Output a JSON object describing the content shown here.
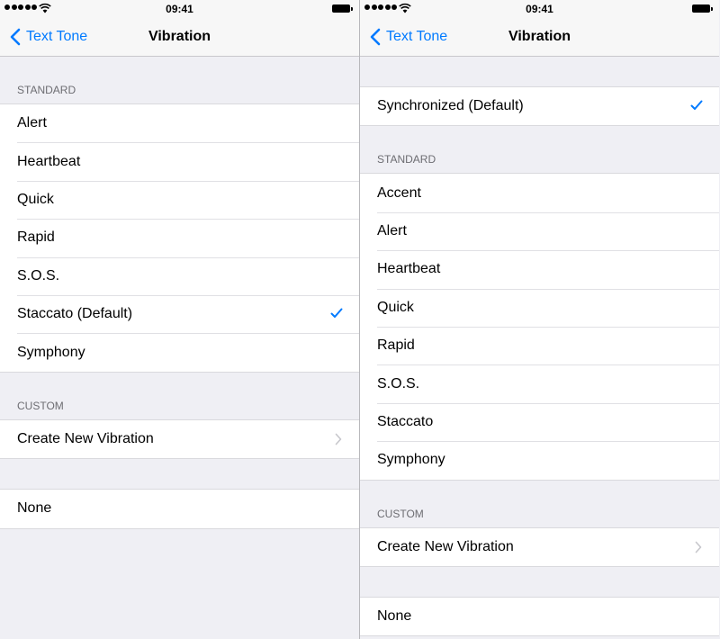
{
  "colors": {
    "accent": "#007aff",
    "background": "#efeff4",
    "header_text": "#6d6d72"
  },
  "left": {
    "status": {
      "time": "09:41"
    },
    "nav": {
      "back": "Text Tone",
      "title": "Vibration"
    },
    "standard_header": "STANDARD",
    "standard": [
      "Alert",
      "Heartbeat",
      "Quick",
      "Rapid",
      "S.O.S.",
      "Staccato (Default)",
      "Symphony"
    ],
    "custom_header": "CUSTOM",
    "create_new": "Create New Vibration",
    "none": "None"
  },
  "right": {
    "status": {
      "time": "09:41"
    },
    "nav": {
      "back": "Text Tone",
      "title": "Vibration"
    },
    "synchronized": "Synchronized (Default)",
    "standard_header": "STANDARD",
    "standard": [
      "Accent",
      "Alert",
      "Heartbeat",
      "Quick",
      "Rapid",
      "S.O.S.",
      "Staccato",
      "Symphony"
    ],
    "custom_header": "CUSTOM",
    "create_new": "Create New Vibration",
    "none": "None"
  }
}
